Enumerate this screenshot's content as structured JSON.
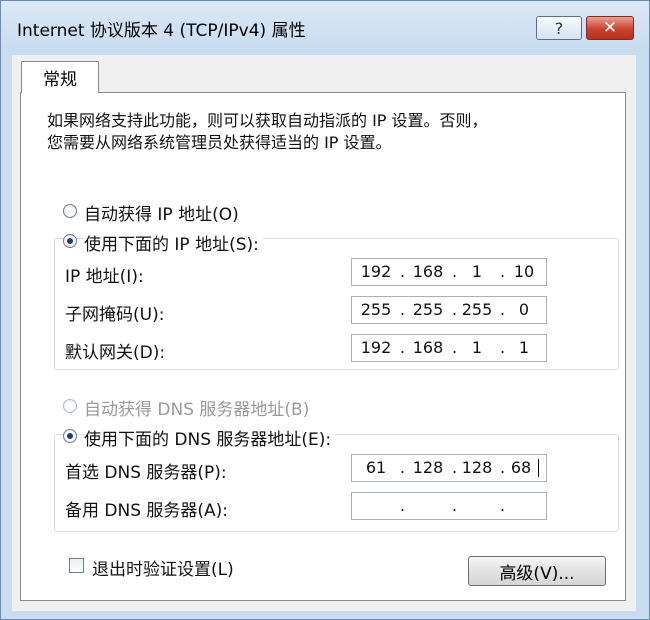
{
  "window": {
    "title": "Internet 协议版本 4 (TCP/IPv4) 属性",
    "help_label": "?",
    "close_label": "✕"
  },
  "tabs": [
    {
      "label": "常规"
    }
  ],
  "description": {
    "line1": "如果网络支持此功能，则可以获取自动指派的 IP 设置。否则，",
    "line2": "您需要从网络系统管理员处获得适当的 IP 设置。"
  },
  "ip_section": {
    "auto_label": "自动获得 IP 地址(O)",
    "manual_label": "使用下面的 IP 地址(S):",
    "selected": "manual",
    "fields": [
      {
        "label": "IP 地址(I):",
        "octets": [
          "192",
          "168",
          "1",
          "10"
        ]
      },
      {
        "label": "子网掩码(U):",
        "octets": [
          "255",
          "255",
          "255",
          "0"
        ]
      },
      {
        "label": "默认网关(D):",
        "octets": [
          "192",
          "168",
          "1",
          "1"
        ]
      }
    ]
  },
  "dns_section": {
    "auto_label": "自动获得 DNS 服务器地址(B)",
    "manual_label": "使用下面的 DNS 服务器地址(E):",
    "selected": "manual",
    "auto_disabled": true,
    "fields": [
      {
        "label": "首选 DNS 服务器(P):",
        "octets": [
          "61",
          "128",
          "128",
          "68"
        ],
        "focused": true
      },
      {
        "label": "备用 DNS 服务器(A):",
        "octets": [
          "",
          "",
          "",
          ""
        ]
      }
    ]
  },
  "validate_on_exit": {
    "label": "退出时验证设置(L)",
    "checked": false
  },
  "advanced_button": {
    "label": "高级(V)..."
  },
  "colors": {
    "title_bar": "#c9dcf0",
    "close_button": "#c9432e",
    "disabled_text": "#9a9a9a"
  }
}
